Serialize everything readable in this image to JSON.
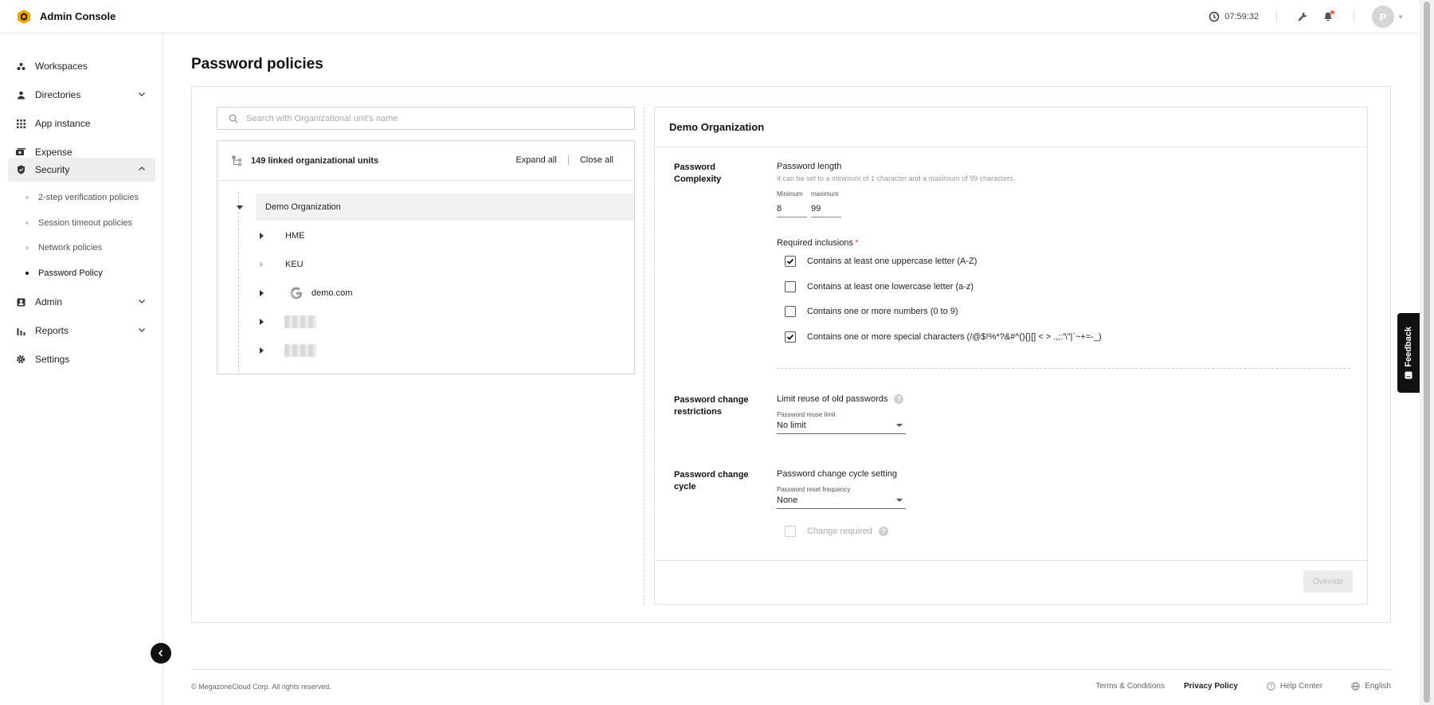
{
  "app": {
    "title": "Admin Console"
  },
  "header": {
    "timer": "07:59:32",
    "avatar_initial": "P"
  },
  "sidebar": {
    "items": [
      {
        "label": "Workspaces"
      },
      {
        "label": "Directories"
      },
      {
        "label": "App instance"
      },
      {
        "label": "Expense"
      },
      {
        "label": "Security"
      },
      {
        "label": "Admin"
      },
      {
        "label": "Reports"
      },
      {
        "label": "Settings"
      }
    ],
    "security_sub": [
      {
        "label": "2-step verification policies"
      },
      {
        "label": "Session timeout policies"
      },
      {
        "label": "Network policies"
      },
      {
        "label": "Password Policy"
      }
    ]
  },
  "page": {
    "title": "Password policies"
  },
  "search": {
    "placeholder": "Search with Organizational unit's name"
  },
  "tree": {
    "count_label": "149 linked organizational units",
    "expand_all": "Expand all",
    "close_all": "Close all",
    "root": "Demo Organization",
    "children": [
      "HME",
      "KEU",
      "demo.com"
    ]
  },
  "policy": {
    "org_title": "Demo Organization",
    "complexity": {
      "section": "Password Complexity",
      "length_title": "Password length",
      "length_hint": "It can be set to a minimum of 1 character and a maximum of 99 characters.",
      "min_label": "Minimum",
      "max_label": "maximum",
      "min_value": "8",
      "max_value": "99",
      "inclusions_title": "Required inclusions",
      "inclusions_required_mark": "*",
      "options": [
        {
          "label": "Contains at least one uppercase letter (A-Z)",
          "checked": true
        },
        {
          "label": "Contains at least one lowercase letter (a-z)",
          "checked": false
        },
        {
          "label": "Contains one or more numbers (0 to 9)",
          "checked": false
        },
        {
          "label": "Contains one or more special characters (/@$!%*?&#^(){}[] < > .,;:'\\\"|`~+=-_)",
          "checked": true
        }
      ]
    },
    "restrictions": {
      "section": "Password change restrictions",
      "title": "Limit reuse of old passwords",
      "sub_label": "Password reuse limit",
      "value": "No limit"
    },
    "cycle": {
      "section": "Password change cycle",
      "title": "Password change cycle setting",
      "sub_label": "Password reset frequency",
      "value": "None",
      "change_required": "Change required"
    },
    "override_label": "Override"
  },
  "footer": {
    "copyright": "© MegazoneCloud Corp. All rights reserved.",
    "terms": "Terms & Conditions",
    "privacy": "Privacy Policy",
    "help": "Help Center",
    "language": "English"
  },
  "feedback": {
    "label": "Feedback"
  },
  "icons": [
    "logo-icon",
    "clock-icon",
    "wrench-icon",
    "bell-icon",
    "workspaces-icon",
    "user-icon",
    "grid-icon",
    "expense-icon",
    "shield-icon",
    "admin-icon",
    "reports-icon",
    "gear-icon",
    "search-icon",
    "org-tree-icon",
    "google-icon",
    "help-icon",
    "globe-icon",
    "chevron-left-icon"
  ],
  "colors": {
    "accent": "#111111",
    "notification": "#ff5a4f",
    "required": "#e5484d"
  }
}
